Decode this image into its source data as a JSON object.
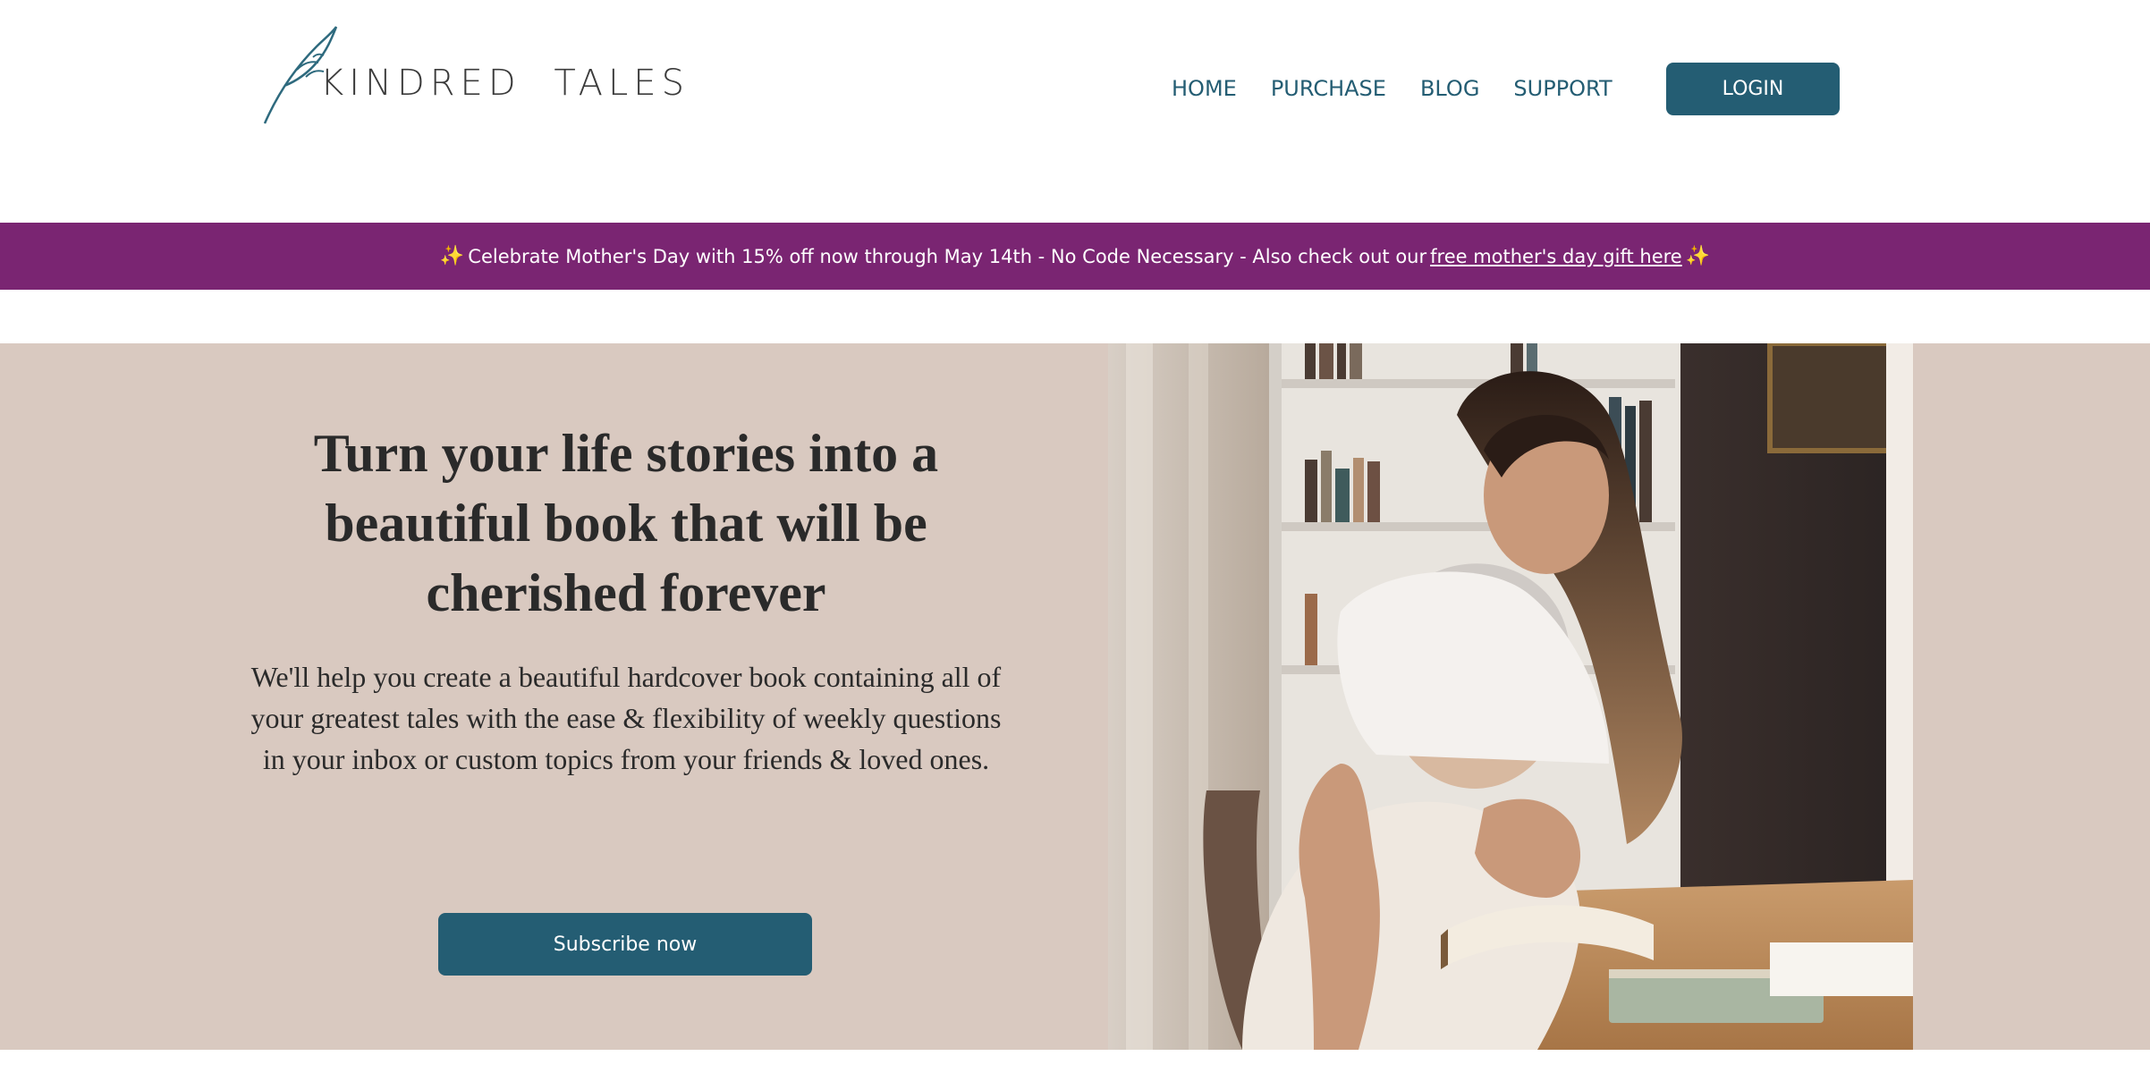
{
  "header": {
    "logo_text": "KINDRED TALES",
    "nav": [
      "HOME",
      "PURCHASE",
      "BLOG",
      "SUPPORT"
    ],
    "login_label": "LOGIN"
  },
  "promo": {
    "text": "Celebrate Mother's Day with 15% off now through May 14th - No Code Necessary - Also check out our",
    "link_text": " free mother's day gift here ",
    "icon": "sparkles-icon",
    "background": "#7a2572"
  },
  "hero": {
    "title": "Turn your life stories into a beautiful book that will be cherished forever",
    "subtitle": "We'll help you create a beautiful hardcover book containing all of your greatest tales with the ease & flexibility of weekly questions in your inbox or custom topics from your friends & loved ones.",
    "cta_label": "Subscribe now",
    "background": "#d9c9c0"
  },
  "colors": {
    "brand": "#245d73",
    "promo": "#7a2572",
    "hero_bg": "#d9c9c0"
  }
}
